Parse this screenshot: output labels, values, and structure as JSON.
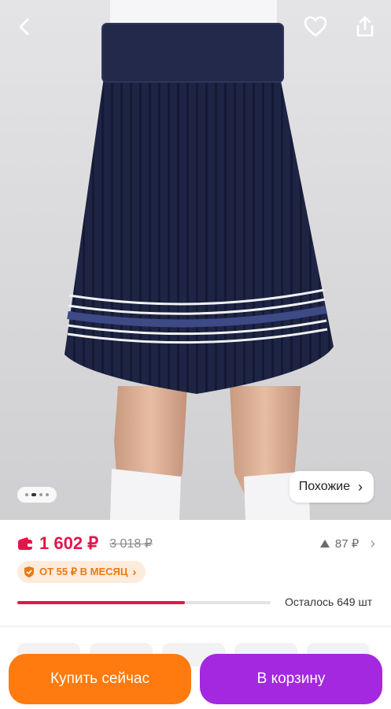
{
  "gallery": {
    "similar_label": "Похожие",
    "pages_total": 4,
    "page_active": 2
  },
  "price": {
    "current": "1 602 ₽",
    "old": "3 018 ₽",
    "rating": "87 ₽"
  },
  "installment": {
    "label": "ОТ 55 ₽ В МЕСЯЦ"
  },
  "stock": {
    "label": "Осталось 649 шт",
    "fraction": 0.66
  },
  "actions": {
    "buy_now": "Купить сейчас",
    "add_to_cart": "В корзину"
  },
  "colors": {
    "price_red": "#e4154b",
    "buy_orange": "#ff7a0f",
    "cart_purple": "#a428df",
    "installment_orange": "#e87a12",
    "skirt_navy": "#1c2240"
  },
  "icons": [
    "back-arrow-icon",
    "heart-icon",
    "share-icon",
    "chevron-right-icon",
    "wallet-icon",
    "price-trend-icon",
    "shield-icon"
  ]
}
